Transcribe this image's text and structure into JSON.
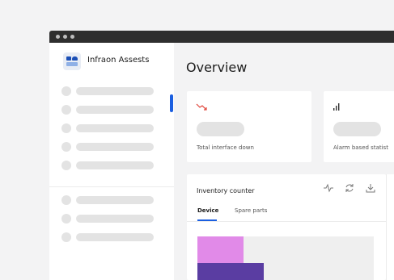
{
  "window": {
    "controls": [
      "dot",
      "dot",
      "dot"
    ]
  },
  "sidebar": {
    "brand": "Infraon Assests",
    "logo_icon": "infraon-logo-icon",
    "active_color": "#1b5fe0"
  },
  "main": {
    "title": "Overview",
    "kpi_cards": [
      {
        "label": "Total interface down",
        "icon": "trend-down-icon",
        "icon_color": "#e0453a"
      },
      {
        "label": "Alarm based statist",
        "icon": "bar-chart-icon",
        "icon_color": "#333333"
      }
    ],
    "inventory": {
      "title": "Inventory counter",
      "tools": [
        "activity-icon",
        "refresh-icon",
        "download-icon"
      ],
      "tabs": [
        {
          "label": "Device",
          "active": true
        },
        {
          "label": "Spare parts",
          "active": false
        }
      ],
      "bar_colors": [
        "#e18ae8",
        "#5a3da2"
      ]
    }
  }
}
